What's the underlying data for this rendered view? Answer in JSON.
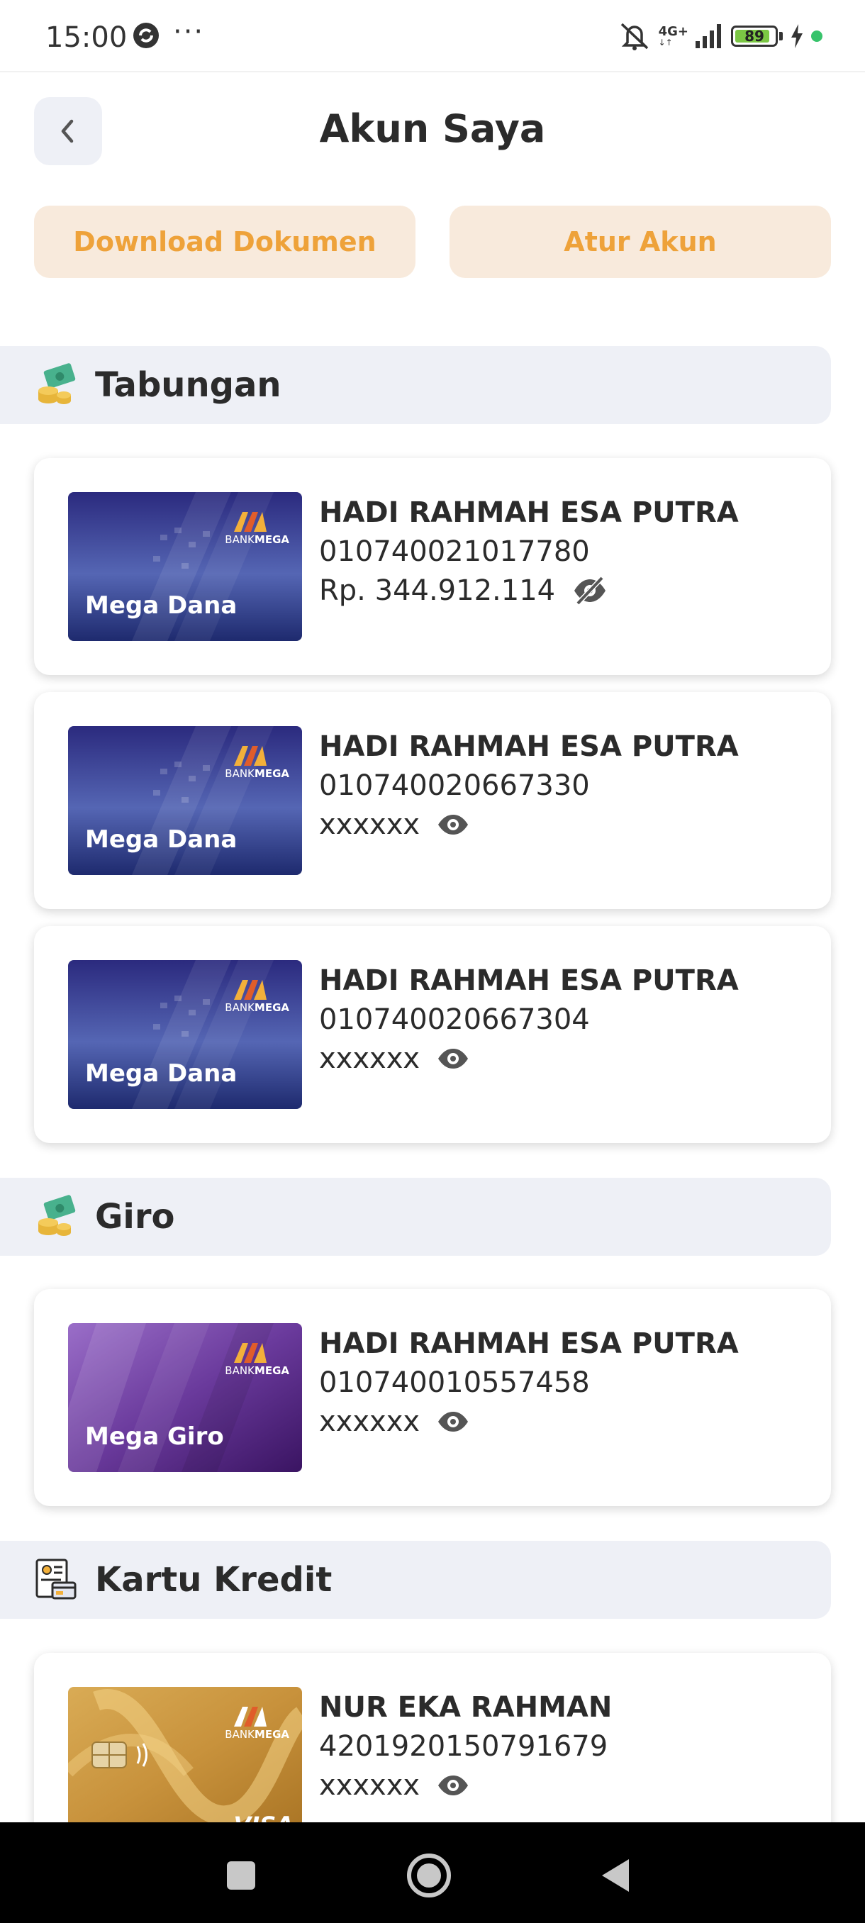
{
  "status_bar": {
    "time": "15:00",
    "more": "···",
    "network": "4G+",
    "battery": "89",
    "battery_level": 0.89
  },
  "header": {
    "title": "Akun Saya",
    "back_icon": "chevron-left-icon"
  },
  "actions": {
    "download_label": "Download Dokumen",
    "settings_label": "Atur Akun"
  },
  "sections": {
    "tabungan": {
      "label": "Tabungan",
      "icon": "money-coins-icon",
      "accounts": [
        {
          "card": "Mega Dana",
          "name": "HADI RAHMAH ESA PUTRA",
          "number": "010740021017780",
          "balance": "Rp. 344.912.114",
          "visibility_icon": "eye-slash-icon"
        },
        {
          "card": "Mega Dana",
          "name": "HADI RAHMAH ESA PUTRA",
          "number": "010740020667330",
          "balance": "xxxxxx",
          "visibility_icon": "eye-icon"
        },
        {
          "card": "Mega Dana",
          "name": "HADI RAHMAH ESA PUTRA",
          "number": "010740020667304",
          "balance": "xxxxxx",
          "visibility_icon": "eye-icon"
        }
      ]
    },
    "giro": {
      "label": "Giro",
      "icon": "money-coins-icon",
      "accounts": [
        {
          "card": "Mega Giro",
          "name": "HADI RAHMAH ESA PUTRA",
          "number": "010740010557458",
          "balance": "xxxxxx",
          "visibility_icon": "eye-icon"
        }
      ]
    },
    "kartu_kredit": {
      "label": "Kartu Kredit",
      "icon": "credit-document-icon",
      "accounts": [
        {
          "card": "VISA",
          "name": "NUR EKA RAHMAN",
          "number": "4201920150791679",
          "balance": "xxxxxx",
          "visibility_icon": "eye-icon"
        }
      ]
    }
  },
  "bank_brand": {
    "prefix": "BANK",
    "name": "MEGA"
  },
  "colors": {
    "accent_orange": "#eea23a",
    "button_bg": "#f8eadc",
    "section_bg": "#eef0f6",
    "mega_dana_blue": "#2c3a8f",
    "mega_giro_purple": "#5e2a8c",
    "credit_gold": "#c99a3e"
  },
  "nav": {
    "recent_icon": "square-icon",
    "home_icon": "circle-home-icon",
    "back_icon": "triangle-back-icon"
  }
}
